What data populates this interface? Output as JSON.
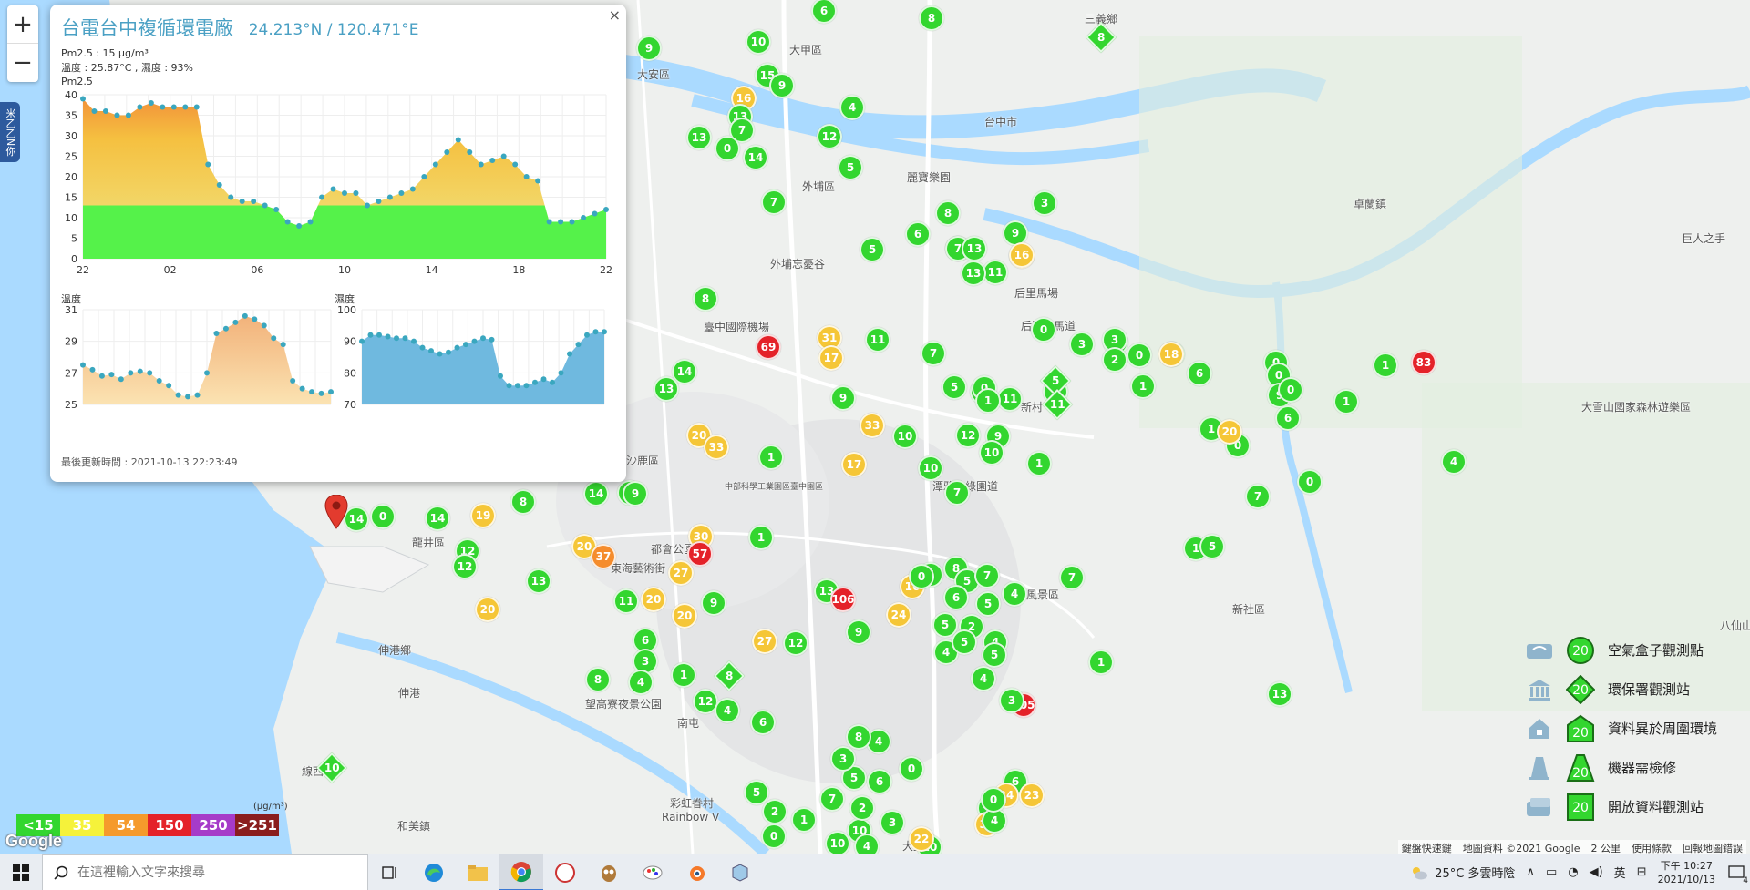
{
  "popup": {
    "station_name": "台電台中複循環電廠",
    "coordinates": "24.213°N / 120.471°E",
    "pm25_line": "Pm2.5 : 15 μg/m³",
    "temp_humidity_line": "溫度 : 25.87°C , 濕度 : 93%",
    "pm25_chart_label": "Pm2.5",
    "temp_chart_label": "溫度",
    "humidity_chart_label": "濕度",
    "last_updated": "最後更新時間 : 2021-10-13 22:23:49",
    "close_label": "×"
  },
  "chart_data": [
    {
      "type": "area",
      "title": "Pm2.5",
      "x_ticks": [
        "22",
        "02",
        "06",
        "10",
        "14",
        "18",
        "22"
      ],
      "y_ticks": [
        0,
        5,
        10,
        15,
        20,
        25,
        30,
        35,
        40
      ],
      "ylim": [
        0,
        40
      ],
      "values": [
        39,
        36,
        36,
        35,
        35,
        37,
        38,
        37,
        37,
        37,
        37,
        23,
        18,
        15,
        14,
        14,
        13,
        12,
        9,
        8,
        9,
        15,
        17,
        16,
        16,
        13,
        14,
        15,
        16,
        17,
        20,
        23,
        26,
        29,
        26,
        23,
        24,
        25,
        23,
        20,
        19,
        9,
        9,
        9,
        10,
        11,
        12
      ]
    },
    {
      "type": "area",
      "title": "溫度",
      "y_ticks": [
        25,
        27,
        29,
        31
      ],
      "ylim": [
        25,
        31
      ],
      "values": [
        27.5,
        27.2,
        26.8,
        26.9,
        26.6,
        27,
        27.1,
        27,
        26.5,
        26.2,
        25.6,
        25.5,
        25.6,
        27,
        29.5,
        29.8,
        30.2,
        30.6,
        30.4,
        30,
        29.2,
        28.8,
        26.5,
        26,
        25.8,
        25.7,
        25.8
      ]
    },
    {
      "type": "area",
      "title": "濕度",
      "y_ticks": [
        70,
        80,
        90,
        100
      ],
      "ylim": [
        70,
        100
      ],
      "values": [
        90,
        92,
        92,
        91.5,
        91,
        91,
        90,
        88,
        87,
        86,
        86.5,
        88,
        89,
        90,
        91,
        90.5,
        79,
        76,
        76,
        76,
        77,
        78,
        77,
        80,
        86,
        89,
        92,
        93,
        93
      ]
    }
  ],
  "map": {
    "places": [
      "三義鄉",
      "大甲區",
      "大安區",
      "外埔區",
      "麗寶樂園",
      "外埔忘憂谷",
      "臺中國際機場",
      "后里馬場",
      "后豐鐵馬道",
      "卓蘭鎮",
      "巨人之手",
      "大雪山國家森林遊樂區",
      "潭雅神綠園道",
      "大坑風景區",
      "新社區",
      "沙鹿區",
      "龍井區",
      "東海藝術街",
      "伸港鄉",
      "伸港",
      "望高寮夜景公園",
      "彩虹眷村",
      "Rainbow V",
      "線西",
      "和美鎮",
      "大里區",
      "台中市",
      "南屯",
      "都會公園",
      "中部科學工業園區臺中園區",
      "八仙山",
      "新村"
    ],
    "markers": [
      {
        "t": "g",
        "v": "6"
      },
      {
        "t": "g",
        "v": "8"
      },
      {
        "t": "g",
        "v": "9"
      },
      {
        "t": "g",
        "v": "10"
      },
      {
        "t": "g",
        "v": "15"
      },
      {
        "t": "g",
        "v": "9"
      },
      {
        "t": "y",
        "v": "16"
      },
      {
        "t": "g",
        "v": "13"
      },
      {
        "t": "g",
        "v": "7"
      },
      {
        "t": "g",
        "v": "13"
      },
      {
        "t": "g",
        "v": "0"
      },
      {
        "t": "g",
        "v": "14"
      },
      {
        "t": "g",
        "v": "4"
      },
      {
        "t": "g",
        "v": "12"
      },
      {
        "t": "g",
        "v": "5"
      },
      {
        "t": "g",
        "v": "7"
      },
      {
        "t": "y",
        "v": "16"
      },
      {
        "t": "g",
        "v": "6"
      },
      {
        "t": "g",
        "v": "8"
      },
      {
        "t": "g",
        "v": "6"
      },
      {
        "t": "g",
        "v": "5"
      },
      {
        "t": "g",
        "v": "7"
      },
      {
        "t": "g",
        "v": "13"
      },
      {
        "t": "g",
        "v": "11"
      },
      {
        "t": "g",
        "v": "9"
      },
      {
        "t": "y",
        "v": "16"
      },
      {
        "t": "g",
        "v": "13"
      },
      {
        "t": "g",
        "v": "3"
      },
      {
        "t": "g",
        "v": "8"
      },
      {
        "t": "r",
        "v": "69"
      },
      {
        "t": "y",
        "v": "31"
      },
      {
        "t": "y",
        "v": "17"
      },
      {
        "t": "g",
        "v": "11"
      },
      {
        "t": "g",
        "v": "7"
      },
      {
        "t": "g",
        "v": "14"
      },
      {
        "t": "g",
        "v": "13"
      },
      {
        "t": "g",
        "v": "9"
      },
      {
        "t": "y",
        "v": "33"
      },
      {
        "t": "g",
        "v": "10"
      },
      {
        "t": "g",
        "v": "12"
      },
      {
        "t": "y",
        "v": "20"
      },
      {
        "t": "y",
        "v": "33"
      },
      {
        "t": "g",
        "v": "1"
      },
      {
        "t": "y",
        "v": "17"
      },
      {
        "t": "g",
        "v": "10"
      },
      {
        "t": "g",
        "v": "5"
      },
      {
        "t": "g",
        "v": "0"
      },
      {
        "t": "g",
        "v": "11"
      },
      {
        "t": "g",
        "v": "9"
      },
      {
        "t": "g",
        "v": "10"
      },
      {
        "t": "g",
        "v": "7"
      },
      {
        "t": "g",
        "v": "1"
      },
      {
        "t": "g",
        "v": "0"
      },
      {
        "t": "g",
        "v": "1"
      },
      {
        "t": "g",
        "v": "1"
      },
      {
        "t": "g",
        "v": "0"
      },
      {
        "t": "g",
        "v": "3"
      },
      {
        "t": "g",
        "v": "0"
      },
      {
        "t": "g",
        "v": "0"
      },
      {
        "t": "g",
        "v": "1"
      },
      {
        "t": "g",
        "v": "3"
      },
      {
        "t": "g",
        "v": "2"
      },
      {
        "t": "g",
        "v": "1"
      },
      {
        "t": "y",
        "v": "18"
      },
      {
        "t": "g",
        "v": "6"
      },
      {
        "t": "g",
        "v": "1"
      },
      {
        "t": "g",
        "v": "0"
      },
      {
        "t": "y",
        "v": "20"
      },
      {
        "t": "g",
        "v": "1"
      },
      {
        "t": "g",
        "v": "5"
      },
      {
        "t": "g",
        "v": "0"
      },
      {
        "t": "g",
        "v": "0"
      },
      {
        "t": "g",
        "v": "9"
      },
      {
        "t": "g",
        "v": "0"
      },
      {
        "t": "g",
        "v": "6"
      },
      {
        "t": "g",
        "v": "1"
      },
      {
        "t": "g",
        "v": "0"
      },
      {
        "t": "g",
        "v": "7"
      },
      {
        "t": "g",
        "v": "1"
      },
      {
        "t": "g",
        "v": "4"
      },
      {
        "t": "r",
        "v": "83"
      },
      {
        "t": "g",
        "v": "6"
      },
      {
        "t": "g",
        "v": "14"
      },
      {
        "t": "g",
        "v": "9"
      },
      {
        "t": "g",
        "v": "8"
      },
      {
        "t": "g",
        "v": "14"
      },
      {
        "t": "g",
        "v": "0"
      },
      {
        "t": "y",
        "v": "19"
      },
      {
        "t": "g",
        "v": "14"
      },
      {
        "t": "g",
        "v": "12"
      },
      {
        "t": "g",
        "v": "12"
      },
      {
        "t": "g",
        "v": "13"
      },
      {
        "t": "y",
        "v": "20"
      },
      {
        "t": "y",
        "v": "20"
      },
      {
        "t": "o",
        "v": "37"
      },
      {
        "t": "y",
        "v": "30"
      },
      {
        "t": "r",
        "v": "57"
      },
      {
        "t": "y",
        "v": "27"
      },
      {
        "t": "g",
        "v": "11"
      },
      {
        "t": "y",
        "v": "20"
      },
      {
        "t": "y",
        "v": "20"
      },
      {
        "t": "g",
        "v": "9"
      },
      {
        "t": "g",
        "v": "6"
      },
      {
        "t": "g",
        "v": "3"
      },
      {
        "t": "g",
        "v": "1"
      },
      {
        "t": "g",
        "v": "8"
      },
      {
        "t": "g",
        "v": "4"
      },
      {
        "t": "g",
        "v": "12"
      },
      {
        "t": "g",
        "v": "4"
      },
      {
        "t": "g",
        "v": "6"
      },
      {
        "t": "g",
        "v": "1"
      },
      {
        "t": "y",
        "v": "27"
      },
      {
        "t": "g",
        "v": "13"
      },
      {
        "t": "r",
        "v": "106"
      },
      {
        "t": "g",
        "v": "12"
      },
      {
        "t": "g",
        "v": "9"
      },
      {
        "t": "y",
        "v": "24"
      },
      {
        "t": "g",
        "v": "5"
      },
      {
        "t": "y",
        "v": "16"
      },
      {
        "t": "g",
        "v": "0"
      },
      {
        "t": "g",
        "v": "8"
      },
      {
        "t": "g",
        "v": "5"
      },
      {
        "t": "g",
        "v": "6"
      },
      {
        "t": "g",
        "v": "5"
      },
      {
        "t": "g",
        "v": "7"
      },
      {
        "t": "g",
        "v": "5"
      },
      {
        "t": "g",
        "v": "2"
      },
      {
        "t": "g",
        "v": "4"
      },
      {
        "t": "g",
        "v": "4"
      },
      {
        "t": "g",
        "v": "5"
      },
      {
        "t": "g",
        "v": "4"
      },
      {
        "t": "r",
        "v": "105"
      },
      {
        "t": "g",
        "v": "3"
      },
      {
        "t": "g",
        "v": "5"
      },
      {
        "t": "g",
        "v": "4"
      },
      {
        "t": "g",
        "v": "7"
      },
      {
        "t": "g",
        "v": "1"
      },
      {
        "t": "g",
        "v": "13"
      },
      {
        "t": "g",
        "v": "6"
      },
      {
        "t": "y",
        "v": "24"
      },
      {
        "t": "y",
        "v": "23"
      },
      {
        "t": "g",
        "v": "9"
      },
      {
        "t": "y",
        "v": "31"
      },
      {
        "t": "g",
        "v": "10"
      },
      {
        "t": "g",
        "v": "10"
      },
      {
        "t": "g",
        "v": "4"
      },
      {
        "t": "g",
        "v": "10"
      },
      {
        "t": "y",
        "v": "22"
      },
      {
        "t": "g",
        "v": "4"
      },
      {
        "t": "g",
        "v": "0"
      },
      {
        "t": "g",
        "v": "3"
      },
      {
        "t": "g",
        "v": "2"
      },
      {
        "t": "g",
        "v": "5"
      },
      {
        "t": "g",
        "v": "0"
      },
      {
        "t": "g",
        "v": "6"
      },
      {
        "t": "g",
        "v": "4"
      },
      {
        "t": "g",
        "v": "8"
      },
      {
        "t": "g",
        "v": "3"
      },
      {
        "t": "g",
        "v": "7"
      },
      {
        "t": "g",
        "v": "1"
      },
      {
        "t": "g",
        "v": "2"
      },
      {
        "t": "g",
        "v": "5"
      },
      {
        "t": "g",
        "v": "0"
      },
      {
        "t": "g",
        "v": "4"
      }
    ],
    "diamonds": [
      {
        "v": "8"
      },
      {
        "v": "5"
      },
      {
        "v": "11"
      },
      {
        "v": "10"
      },
      {
        "v": "8"
      }
    ]
  },
  "aqi_scale": [
    {
      "label": "<15",
      "color": "#33d62f"
    },
    {
      "label": "35",
      "color": "#f5f23a"
    },
    {
      "label": "54",
      "color": "#f59a2c"
    },
    {
      "label": "150",
      "color": "#e42229"
    },
    {
      "label": "250",
      "color": "#a63bc9"
    },
    {
      "label": ">251",
      "color": "#8a1d1d"
    }
  ],
  "aqi_unit": "(μg/m³)",
  "google_logo": "Google",
  "legend": {
    "sample_value": "20",
    "items": [
      {
        "label": "空氣盒子觀測點",
        "icon": "airbox-icon",
        "shape": "circle"
      },
      {
        "label": "環保署觀測站",
        "icon": "government-building-icon",
        "shape": "diamond"
      },
      {
        "label": "資料異於周圍環境",
        "icon": "house-icon",
        "shape": "house"
      },
      {
        "label": "機器需檢修",
        "icon": "cone-icon",
        "shape": "triangle"
      },
      {
        "label": "開放資料觀測站",
        "icon": "open-data-icon",
        "shape": "square"
      }
    ]
  },
  "attribution": {
    "shortcuts": "鍵盤快速鍵",
    "map_data": "地圖資料 ©2021 Google",
    "scale": "2 公里",
    "terms": "使用條款",
    "report": "回報地圖錯誤"
  },
  "taskbar": {
    "search_placeholder": "在這裡輸入文字來搜尋",
    "weather": "25°C 多雲時陰",
    "ime": "英",
    "time": "下午 10:27",
    "date": "2021/10/13",
    "notification_count": "4"
  },
  "zoom": {
    "in": "+",
    "out": "−"
  },
  "side_tab": "米乙乙N你"
}
